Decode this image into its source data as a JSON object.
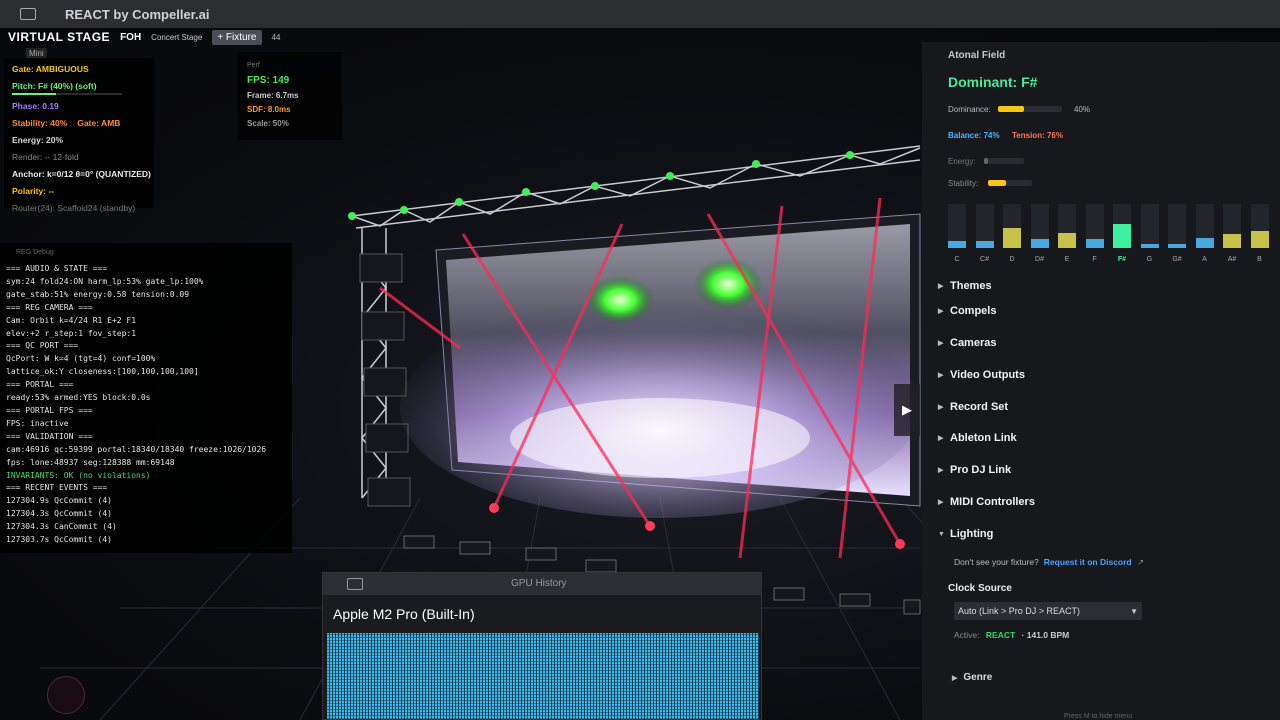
{
  "window": {
    "title": "REACT by Compeller.ai"
  },
  "toolbar": {
    "stage_label": "VIRTUAL STAGE",
    "foh": "FOH",
    "preset": "Concert Stage",
    "add_fixture": "+ Fixture",
    "count": "44",
    "mini": "Mini"
  },
  "status": {
    "gate": "Gate: AMBIGUOUS",
    "pitch": "Pitch: F# (40%) (soft)",
    "phase": "Phase: 0.19",
    "stability": "Stability: 40%",
    "gate_short": "Gate: AMB",
    "energy": "Energy: 20%",
    "render": "Render: -- 12-fold",
    "anchor": "Anchor: k=0/12 θ=0° (QUANTIZED)",
    "polarity": "Polarity: --",
    "router": "Router(24): Scaffold24 (standby)",
    "pitch_level": 0.4
  },
  "perf": {
    "header": "Perf",
    "fps": "FPS: 149",
    "frame": "Frame: 6.7ms",
    "sdf": "SDF: 8.0ms",
    "scale": "Scale: 50%"
  },
  "debug": {
    "header": "REG Debug",
    "lines": [
      "=== AUDIO & STATE ===",
      "sym:24 fold24:ON harm_lp:53% gate_lp:100%",
      "gate_stab:51% energy:0.58 tension:0.09",
      "=== REG CAMERA ===",
      "Cam: Orbit k=4/24 R1 E+2 F1",
      "elev:+2 r_step:1 fov_step:1",
      "=== QC PORT ===",
      "QcPort: W k=4 (tgt=4) conf=100%",
      "lattice_ok:Y closeness:[100,100,100,100]",
      "=== PORTAL ===",
      "ready:53% armed:YES block:0.0s",
      "=== PORTAL FPS ===",
      "FPS: inactive",
      "=== VALIDATION ===",
      "cam:46916 qc:59399 portal:18340/18340 freeze:1026/1026",
      "fps: lone:48937 seg:128388 mm:69148",
      "INVARIANTS: OK (no violations)",
      "=== RECENT EVENTS ===",
      "127304.9s QcCommit (4)",
      "127304.3s QcCommit (4)",
      "127304.3s CanCommit (4)",
      "127303.7s QcCommit (4)"
    ]
  },
  "atonal": {
    "header": "Atonal Field",
    "dominant": "Dominant: F#",
    "dominance_label": "Dominance:",
    "dominance_pct": "40%",
    "dominance_level": 0.4,
    "balance": "Balance: 74%",
    "tension": "Tension: 76%",
    "energy_label": "Energy:",
    "energy_level": 0.1,
    "stability_label": "Stability:",
    "stability_level": 0.4,
    "notes": [
      "C",
      "C#",
      "D",
      "D#",
      "E",
      "F",
      "F#",
      "G",
      "G#",
      "A",
      "A#",
      "B"
    ],
    "note_levels": [
      0.15,
      0.15,
      0.45,
      0.2,
      0.35,
      0.2,
      0.55,
      0.1,
      0.08,
      0.22,
      0.32,
      0.38
    ],
    "note_active": "F#"
  },
  "sections": {
    "themes": "Themes",
    "compels": "Compels",
    "cameras": "Cameras",
    "video_outputs": "Video Outputs",
    "record_set": "Record Set",
    "ableton_link": "Ableton Link",
    "pro_dj_link": "Pro DJ Link",
    "midi_controllers": "MIDI Controllers",
    "lighting": "Lighting"
  },
  "lighting": {
    "fixture_q": "Don't see your fixture?",
    "fixture_link": "Request it on Discord",
    "clock_source": "Clock Source",
    "clock_value": "Auto  (Link > Pro DJ > REACT)",
    "active_label": "Active:",
    "active_value": "REACT",
    "bpm": "· 141.0 BPM",
    "genre": "Genre"
  },
  "gpu": {
    "title": "GPU History",
    "device": "Apple M2 Pro (Built-In)"
  },
  "footer": {
    "hint": "Press M to hide menu"
  },
  "colors": {
    "accent_green": "#4de89e",
    "yellow": "#f5c518",
    "link_blue": "#4da3ff",
    "laser_red": "#ff2a55"
  }
}
